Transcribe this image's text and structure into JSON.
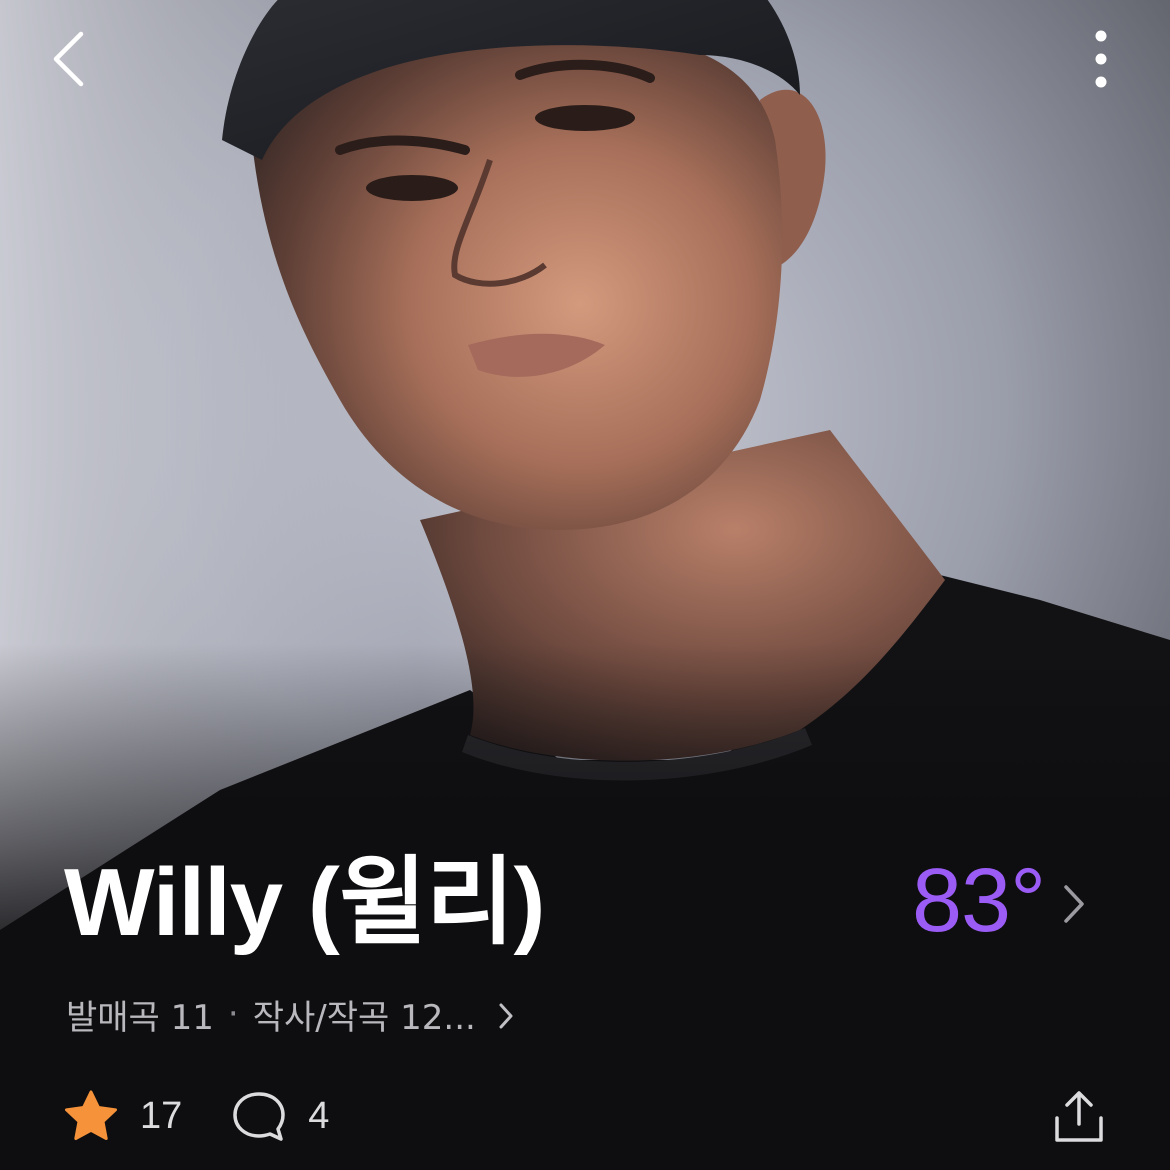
{
  "header": {
    "back_icon": "chevron-left-icon",
    "more_icon": "vertical-ellipsis-icon"
  },
  "artist": {
    "name": "Willy (윌리)",
    "temperature": "83°",
    "temperature_color": "#9b5cf6",
    "released_label": "발매곡 11",
    "written_label": "작사/작곡 12..."
  },
  "actions": {
    "like_count": "17",
    "comment_count": "4",
    "like_icon": "star-icon",
    "like_color": "#f5923a",
    "comment_icon": "comment-bubble-icon",
    "share_icon": "share-icon"
  }
}
